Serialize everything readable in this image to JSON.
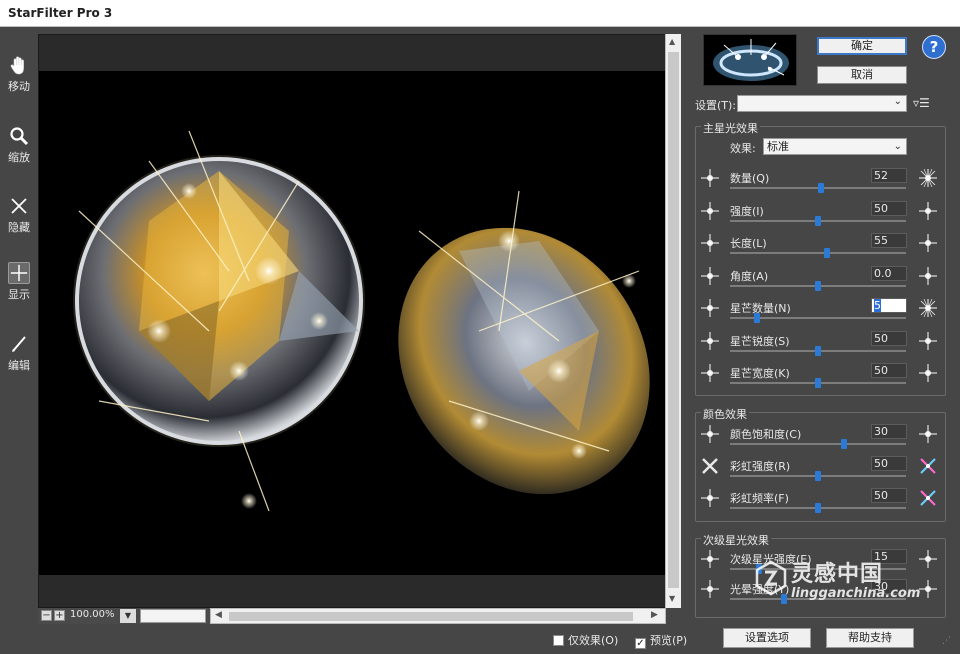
{
  "window": {
    "title": "StarFilter Pro 3"
  },
  "tools": [
    {
      "label": "移动",
      "icon": "hand-icon"
    },
    {
      "label": "缩放",
      "icon": "magnifier-icon"
    },
    {
      "label": "隐藏",
      "icon": "cross-icon"
    },
    {
      "label": "显示",
      "icon": "plus-icon"
    },
    {
      "label": "编辑",
      "icon": "pen-icon"
    }
  ],
  "canvas": {
    "zoom": "100.00%"
  },
  "footer": {
    "effect_only": "仅效果(O)",
    "effect_only_checked": false,
    "preview": "预览(P)",
    "preview_checked": true,
    "options_button": "设置选项",
    "help_button": "帮助支持"
  },
  "panel": {
    "ok_button": "确定",
    "cancel_button": "取消",
    "help_icon": "?",
    "settings_label": "设置(T):",
    "settings_value": "",
    "main": {
      "title": "主星光效果",
      "effect_label": "效果:",
      "effect_value": "标准",
      "rows": [
        {
          "label": "数量(Q)",
          "value": "52",
          "level": 0.52
        },
        {
          "label": "强度(I)",
          "value": "50",
          "level": 0.5
        },
        {
          "label": "长度(L)",
          "value": "55",
          "level": 0.55
        },
        {
          "label": "角度(A)",
          "value": "0.0",
          "level": 0.5
        },
        {
          "label": "星芒数量(N)",
          "value": "5",
          "level": 0.14
        },
        {
          "label": "星芒锐度(S)",
          "value": "50",
          "level": 0.5
        },
        {
          "label": "星芒宽度(K)",
          "value": "50",
          "level": 0.5
        }
      ]
    },
    "color": {
      "title": "颜色效果",
      "rows": [
        {
          "label": "颜色饱和度(C)",
          "value": "30",
          "level": 0.65
        },
        {
          "label": "彩虹强度(R)",
          "value": "50",
          "level": 0.5
        },
        {
          "label": "彩虹频率(F)",
          "value": "50",
          "level": 0.5
        }
      ]
    },
    "secondary": {
      "title": "次级星光效果",
      "rows": [
        {
          "label": "次级星光强度(E)",
          "value": "15",
          "level": 0.15
        },
        {
          "label": "光晕强度(Y)",
          "value": "30",
          "level": 0.3
        }
      ]
    }
  },
  "watermark": {
    "main": "灵感中国",
    "sub": "lingganchina.com"
  },
  "colors": {
    "accent": "#2b7ad6",
    "background": "#464646"
  }
}
